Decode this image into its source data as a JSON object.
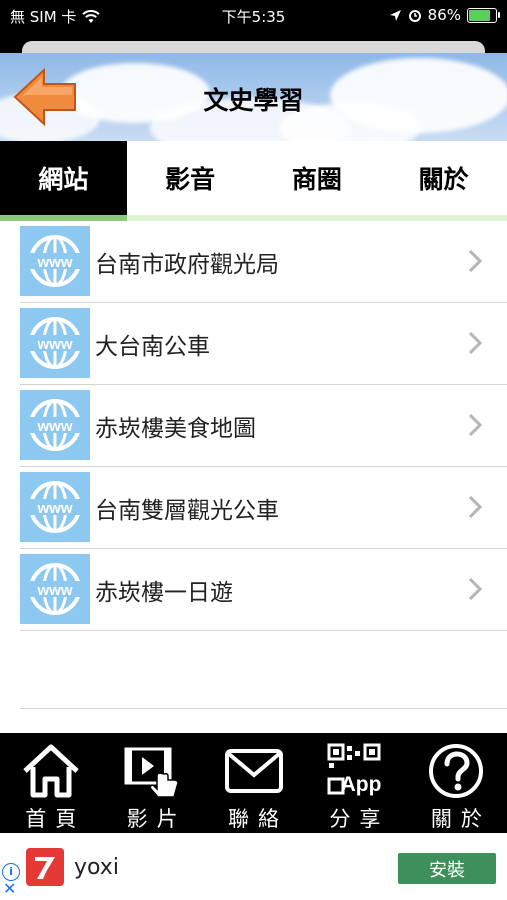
{
  "status_bar": {
    "carrier": "無 SIM 卡",
    "time": "下午5:35",
    "battery": "86%"
  },
  "header": {
    "title": "文史學習"
  },
  "tabs": [
    {
      "label": "網站",
      "active": true
    },
    {
      "label": "影音",
      "active": false
    },
    {
      "label": "商圈",
      "active": false
    },
    {
      "label": "關於",
      "active": false
    }
  ],
  "websites": [
    {
      "label": "台南市政府觀光局",
      "icon": "www-globe-icon"
    },
    {
      "label": "大台南公車",
      "icon": "www-globe-icon"
    },
    {
      "label": "赤崁樓美食地圖",
      "icon": "www-globe-icon"
    },
    {
      "label": "台南雙層觀光公車",
      "icon": "www-globe-icon"
    },
    {
      "label": "赤崁樓一日遊",
      "icon": "www-globe-icon"
    }
  ],
  "bottom_nav": [
    {
      "label": "首頁",
      "icon": "home-icon"
    },
    {
      "label": "影片",
      "icon": "video-icon"
    },
    {
      "label": "聯絡",
      "icon": "mail-icon"
    },
    {
      "label": "分享",
      "icon": "qr-app-icon"
    },
    {
      "label": "關於",
      "icon": "question-icon"
    }
  ],
  "ad": {
    "app_name": "yoxi",
    "install_label": "安裝",
    "info_glyph": "i",
    "close_glyph": "✕"
  },
  "colors": {
    "www_icon_bg": "#8cc8ef",
    "active_tab": "#000000",
    "install_button": "#3f8f5a",
    "back_arrow": "#f08a3c"
  }
}
